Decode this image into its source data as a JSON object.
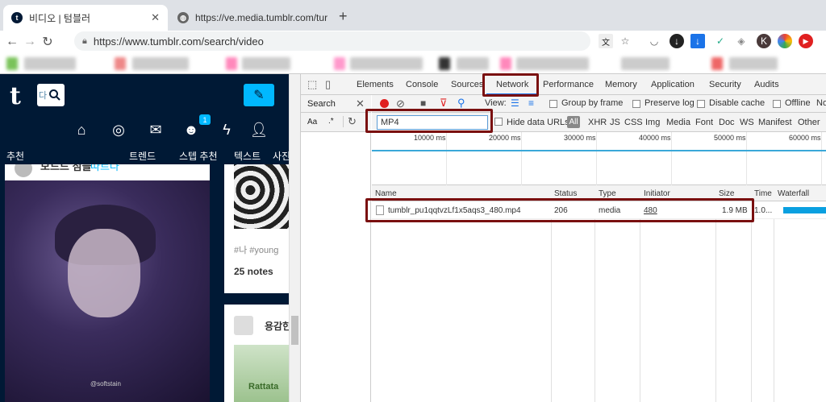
{
  "tabs": [
    {
      "title": "비디오 | 텀블러",
      "close": "✕"
    },
    {
      "title": "https://ve.media.tumblr.com/tur",
      "close": "✕"
    }
  ],
  "new_tab": "+",
  "address": "https://www.tumblr.com/search/video",
  "tumblr": {
    "logo": "t",
    "search_text": "다",
    "badge_count": "1",
    "nav": [
      "추천",
      "트렌드",
      "스텝 추천",
      "텍스트",
      "사진"
    ],
    "post1": {
      "user": "모드드 점들",
      "follow": "따르다",
      "watermark": "@softstain"
    },
    "post2": {
      "tags": "#나   #young",
      "notes": "25 notes"
    },
    "post3": {
      "user": "용감한",
      "label": "Rattata"
    }
  },
  "devtools": {
    "tabs": [
      "Elements",
      "Console",
      "Sources",
      "Network",
      "Performance",
      "Memory",
      "Application",
      "Security",
      "Audits"
    ],
    "active_tab": "Network",
    "search_label": "Search",
    "search_aa": "Aa",
    "search_regex": ".*",
    "view_label": "View:",
    "options": [
      "Group by frame",
      "Preserve log",
      "Disable cache",
      "Offline",
      "No"
    ],
    "filter_value": "MP4",
    "hide_data_urls": "Hide data URLs",
    "all_label": "All",
    "types": [
      "XHR",
      "JS",
      "CSS",
      "Img",
      "Media",
      "Font",
      "Doc",
      "WS",
      "Manifest",
      "Other"
    ],
    "ticks": [
      "10000 ms",
      "20000 ms",
      "30000 ms",
      "40000 ms",
      "50000 ms",
      "60000 ms"
    ],
    "columns": [
      "Name",
      "Status",
      "Type",
      "Initiator",
      "Size",
      "Time",
      "Waterfall"
    ],
    "row": {
      "name": "tumblr_pu1qqtvzLf1x5aqs3_480.mp4",
      "status": "206",
      "type": "media",
      "initiator": "480",
      "size": "1.9 MB",
      "time": "1.0..."
    }
  },
  "colors": {
    "tumblr_navy": "#001935",
    "tumblr_blue": "#00b8ff",
    "highlight": "#7a1010",
    "chrome_tabstrip": "#dee1e6"
  }
}
